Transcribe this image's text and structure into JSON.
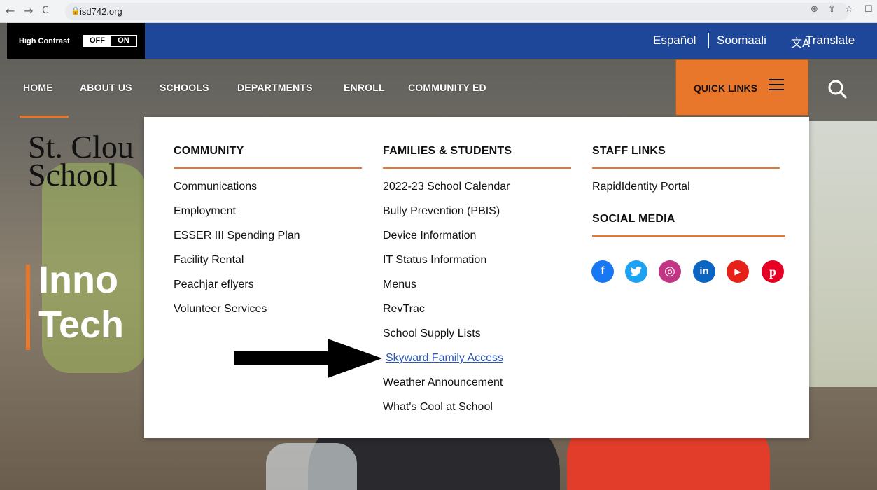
{
  "browser": {
    "back": "←",
    "forward": "→",
    "reload": "C",
    "url": "isd742.org",
    "zoom_icon": "⊕",
    "share_icon": "⇧",
    "star_icon": "☆",
    "window_icon": "☐"
  },
  "topbar": {
    "high_contrast": {
      "label": "High Contrast",
      "off": "OFF",
      "on": "ON"
    },
    "languages": [
      "Español",
      "Soomaali"
    ],
    "translate": "Translate",
    "translate_icon": "文A"
  },
  "nav": {
    "items": [
      "HOME",
      "ABOUT US",
      "SCHOOLS",
      "DEPARTMENTS",
      "ENROLL",
      "COMMUNITY ED"
    ],
    "quick_links": "QUICK LINKS"
  },
  "hero": {
    "title_line1": "St. Clou",
    "title_line2": "School",
    "tag_line1": "Inno",
    "tag_line2": "Tech"
  },
  "dropdown": {
    "community": {
      "heading": "COMMUNITY",
      "links": [
        "Communications",
        "Employment",
        "ESSER III Spending Plan",
        "Facility Rental",
        "Peachjar eflyers",
        "Volunteer Services"
      ]
    },
    "families": {
      "heading": "FAMILIES & STUDENTS",
      "links": [
        "2022-23 School Calendar",
        "Bully Prevention (PBIS)",
        "Device Information",
        "IT Status Information",
        "Menus",
        "RevTrac",
        "School Supply Lists",
        "Skyward Family Access",
        "Weather Announcement",
        "What's Cool at School"
      ],
      "highlighted": "Skyward Family Access"
    },
    "staff": {
      "heading": "STAFF LINKS",
      "links": [
        "RapidIdentity Portal"
      ]
    },
    "social": {
      "heading": "SOCIAL MEDIA",
      "icons": [
        {
          "name": "facebook",
          "glyph": "f",
          "color": "#1877f2"
        },
        {
          "name": "twitter",
          "glyph": "t",
          "color": "#1da1f2"
        },
        {
          "name": "instagram",
          "glyph": "◎",
          "color": "#c13584"
        },
        {
          "name": "linkedin",
          "glyph": "in",
          "color": "#0a66c2"
        },
        {
          "name": "youtube",
          "glyph": "▶",
          "color": "#e62117"
        },
        {
          "name": "pinterest",
          "glyph": "p",
          "color": "#e60023"
        }
      ]
    }
  },
  "colors": {
    "accent": "#e8772b",
    "topbar": "#1e4799",
    "link_active": "#2a56b5"
  }
}
